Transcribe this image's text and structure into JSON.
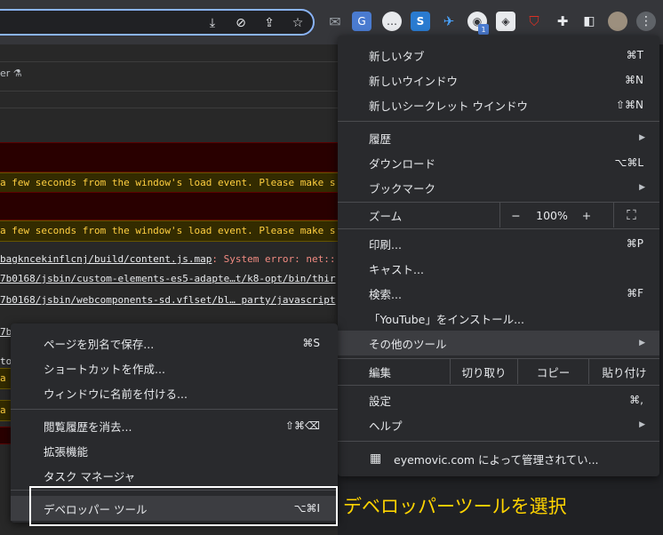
{
  "toolbar": {
    "omnibox_icons": [
      "download-icon",
      "eye-off-icon",
      "share-icon",
      "star-icon"
    ],
    "extensions": [
      "mail-icon",
      "translate-icon",
      "message-icon",
      "s-icon",
      "send-icon",
      "github-icon",
      "box-icon",
      "shield-icon",
      "puzzle-icon",
      "sidebar-icon",
      "avatar",
      "more-icon"
    ],
    "github_badge": "1"
  },
  "devtools": {
    "filter_label": "er ⚗",
    "rows": [
      {
        "text": "a few seconds from the window's load event. Please make s"
      },
      {
        "text": "a few seconds from the window's load event. Please make s"
      },
      {
        "link": "bagkncekinflcnj/build/content.js.map",
        "rest": ": System error: net::"
      },
      {
        "link": "7b0168/jsbin/custom-elements-es5-adapte…t/k8-opt/bin/thir"
      },
      {
        "link": "7b0168/jsbin/webcomponents-sd.vflset/bl… party/javascript"
      },
      {
        "link": "7b"
      },
      {
        "text": "to"
      },
      {
        "text": "a"
      },
      {
        "text": "a"
      }
    ]
  },
  "menu": {
    "new_tab": "新しいタブ",
    "new_tab_sc": "⌘T",
    "new_window": "新しいウインドウ",
    "new_window_sc": "⌘N",
    "new_incognito": "新しいシークレット ウインドウ",
    "new_incognito_sc": "⇧⌘N",
    "history": "履歴",
    "downloads": "ダウンロード",
    "downloads_sc": "⌥⌘L",
    "bookmarks": "ブックマーク",
    "zoom_label": "ズーム",
    "zoom_minus": "−",
    "zoom_value": "100%",
    "zoom_plus": "+",
    "fullscreen": "⛶",
    "print": "印刷...",
    "print_sc": "⌘P",
    "cast": "キャスト...",
    "find": "検索...",
    "find_sc": "⌘F",
    "install": "「YouTube」をインストール...",
    "more_tools": "その他のツール",
    "edit_label": "編集",
    "cut": "切り取り",
    "copy": "コピー",
    "paste": "貼り付け",
    "settings": "設定",
    "settings_sc": "⌘,",
    "help": "ヘルプ",
    "managed": "eyemovic.com によって管理されてい..."
  },
  "submenu": {
    "save_page": "ページを別名で保存...",
    "save_page_sc": "⌘S",
    "create_shortcut": "ショートカットを作成...",
    "name_window": "ウィンドウに名前を付ける...",
    "clear_data": "閲覧履歴を消去...",
    "clear_data_sc": "⇧⌘⌫",
    "extensions": "拡張機能",
    "task_manager": "タスク マネージャ",
    "dev_tools": "デベロッパー ツール",
    "dev_tools_sc": "⌥⌘I"
  },
  "caption": "デベロッパーツールを選択"
}
